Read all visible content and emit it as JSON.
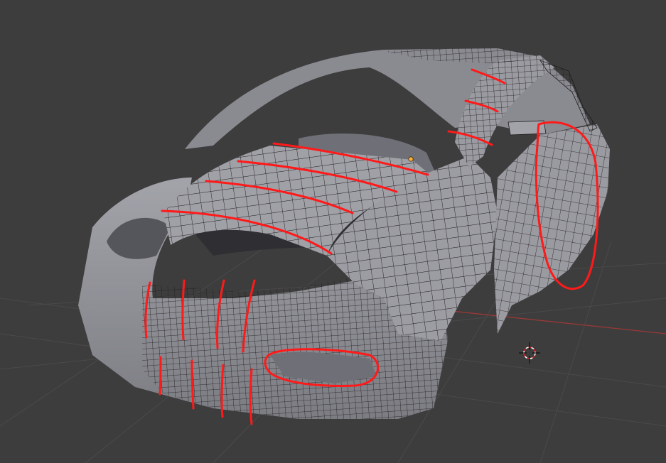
{
  "app": {
    "view": "3d-viewport",
    "mode": "edit-mode-wireframe-overlay"
  },
  "colors": {
    "background": "#3d3d3d",
    "grid": "#4a4a4a",
    "mesh_surface": "#8e8e95",
    "mesh_dark": "#5b5b61",
    "wire": "#1c1c1c",
    "annotation": "#ff1a1a",
    "x_axis": "#9a3838",
    "cursor_red": "#ffffff",
    "selected_vertex": "#ffae3a"
  },
  "icons": {
    "cursor": "3d-cursor-icon",
    "origin": "object-origin-icon"
  }
}
